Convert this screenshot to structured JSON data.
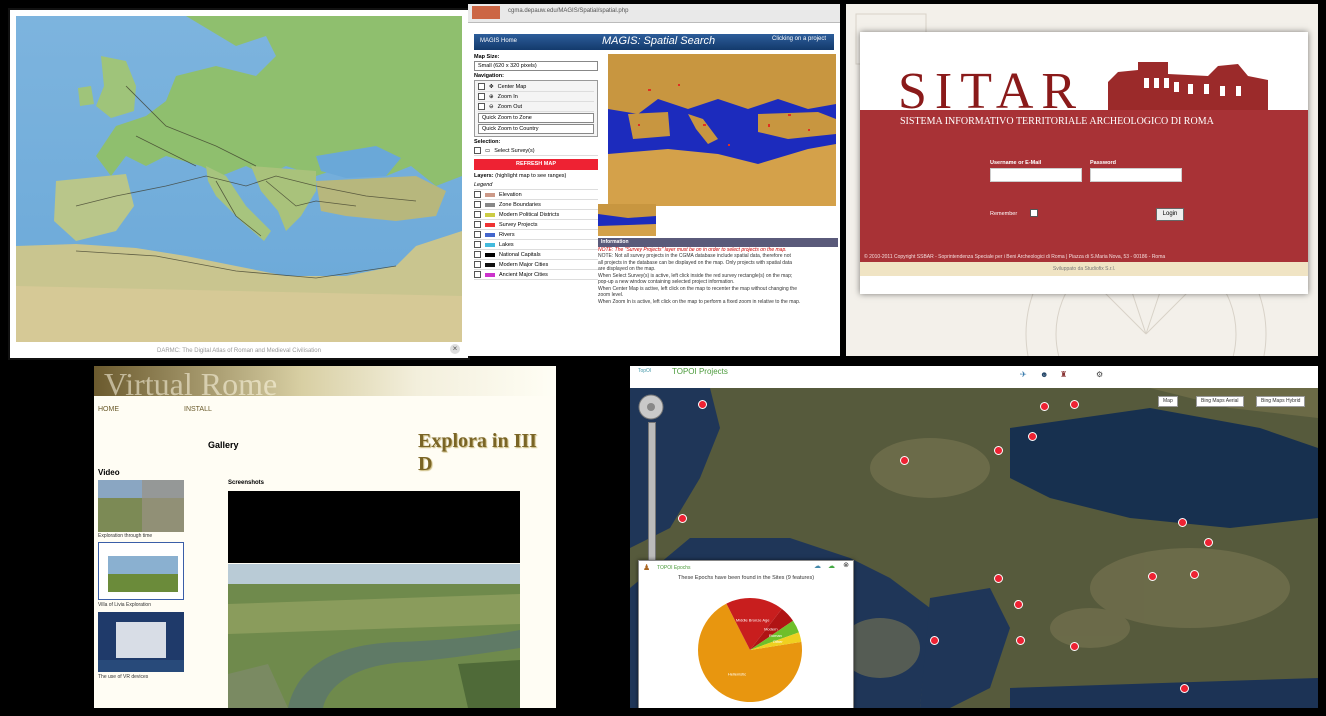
{
  "darmc": {
    "caption": "DARMC: The Digital Atlas of Roman and Medieval Civilisation",
    "close_icon": "close-icon"
  },
  "magis": {
    "url": "cgma.depauw.edu/MAGIS/Spatial/spatial.php",
    "home": "MAGIS Home",
    "title": "MAGIS: Spatial Search",
    "clicking_note": "Clicking on a project",
    "map_size_label": "Map Size:",
    "map_size_value": "Small (620 x 320 pixels)",
    "navigation_label": "Navigation:",
    "nav_items": [
      "Center Map",
      "Zoom In",
      "Zoom Out"
    ],
    "quick_zone": "Quick Zoom to Zone",
    "quick_country": "Quick Zoom to Country",
    "selection_label": "Selection:",
    "select_surveys": "Select Survey(s)",
    "refresh": "REFRESH MAP",
    "layers_label": "Layers:",
    "layers_hint": "(highlight map to see ranges)",
    "legend_label": "Legend",
    "layers": [
      {
        "name": "Elevation",
        "color": "#c98"
      },
      {
        "name": "Zone Boundaries",
        "color": "#888"
      },
      {
        "name": "Modern Political Districts",
        "color": "#cc4"
      },
      {
        "name": "Survey Projects",
        "color": "#e33"
      },
      {
        "name": "Rivers",
        "color": "#46c"
      },
      {
        "name": "Lakes",
        "color": "#4bd"
      },
      {
        "name": "National Capitals",
        "color": "#000"
      },
      {
        "name": "Modern Major Cities",
        "color": "#111"
      },
      {
        "name": "Ancient Major Cities",
        "color": "#c3c"
      }
    ],
    "info_header": "Information",
    "info_note": "NOTE: The \"Survey Projects\" layer must be on in order to select projects on the map.",
    "info_lines": [
      "NOTE: Not all survey projects in the CGMA database include spatial data, therefore not",
      "all projects in the database can be displayed on the map. Only projects with spatial data",
      "are displayed on the map.",
      "When Select Survey(s) is active, left click inside the red survey rectangle(s) on the map;",
      "pop-up a new window containing selected project information.",
      "When Center Map is active, left click on the map to recenter the map without changing the",
      "zoom level.",
      "When Zoom In is active, left click on the map to perform a fixed zoom in relative to the map."
    ]
  },
  "sitar": {
    "logo": "SITAR",
    "subtitle": "SISTEMA INFORMATIVO TERRITORIALE ARCHEOLOGICO DI ROMA",
    "username_label": "Username or E-Mail",
    "password_label": "Password",
    "remember_label": "Remember",
    "login": "Login",
    "copyright": "© 2010-2011 Copyright SSBAR - Soprintendenza Speciale per i Beni Archeologici di Roma | Piazza di S.Maria Nova, 53 - 00186 - Roma",
    "footer": "Sviluppato da Studiofix S.r.l."
  },
  "vrome": {
    "banner": "Virtual Rome",
    "nav_home": "HOME",
    "nav_install": "INSTALL",
    "gallery": "Gallery",
    "explora": "Explora in III D",
    "video": "Video",
    "screenshots": "Screenshots",
    "thumbs": [
      "Exploration through time",
      "Villa of Livia Exploration",
      "The use of VR devices"
    ]
  },
  "topoi": {
    "tiny": "TopOI",
    "title": "TOPOI Projects",
    "btn_map": "Map",
    "btn_aerial": "Bing Maps Aerial",
    "btn_hybrid": "Bing Maps Hybrid",
    "popup_head": "TOPOI Epochs",
    "popup_title": "These Epochs have been found in the Sites (9 features)",
    "pie": [
      {
        "label": "Hellenistic",
        "value": 70,
        "color": "#e8960f"
      },
      {
        "label": "Middle Bronze Age",
        "value": 18,
        "color": "#c81e1e"
      },
      {
        "label": "Modern",
        "value": 5,
        "color": "#b01414"
      },
      {
        "label": "Roman",
        "value": 4,
        "color": "#6fbf2a"
      },
      {
        "label": "Other",
        "value": 3,
        "color": "#f0d020"
      }
    ]
  }
}
